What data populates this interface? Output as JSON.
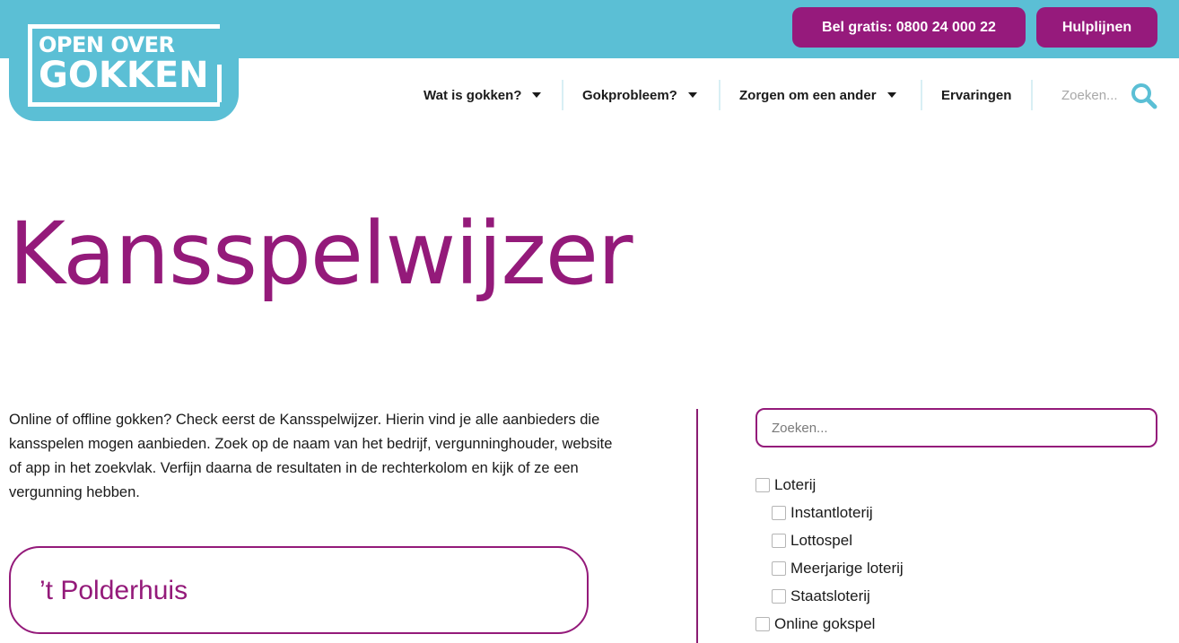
{
  "header": {
    "logo_line1": "OPEN OVER",
    "logo_line2": "GOKKEN",
    "call_button": "Bel gratis: 0800 24 000 22",
    "help_button": "Hulplijnen",
    "brand_color": "#5bbfd5",
    "accent_color": "#941a7a"
  },
  "nav": {
    "items": [
      {
        "label": "Wat is gokken?",
        "has_dropdown": true
      },
      {
        "label": "Gokprobleem?",
        "has_dropdown": true
      },
      {
        "label": "Zorgen om een ander",
        "has_dropdown": true
      },
      {
        "label": "Ervaringen",
        "has_dropdown": false
      }
    ],
    "search_placeholder": "Zoeken...",
    "search_icon": "search-icon"
  },
  "main": {
    "title": "Kansspelwijzer",
    "intro": "Online of offline gokken? Check eerst de Kansspelwijzer. Hierin vind je alle aanbieders die kansspelen mogen aanbieden. Zoek op de naam van het bedrijf, vergunninghouder, website of app in het zoekvlak. Verfijn daarna de resultaten in de rechterkolom en kijk of ze een vergunning hebben.",
    "results": [
      {
        "name": "’t Polderhuis"
      }
    ]
  },
  "filters": {
    "search_placeholder": "Zoeken...",
    "options": [
      {
        "label": "Loterij",
        "checked": false
      },
      {
        "label": "Instantloterij",
        "checked": false
      },
      {
        "label": "Lottospel",
        "checked": false
      },
      {
        "label": "Meerjarige loterij",
        "checked": false
      },
      {
        "label": "Staatsloterij",
        "checked": false
      },
      {
        "label": "Online gokspel",
        "checked": false
      }
    ]
  }
}
